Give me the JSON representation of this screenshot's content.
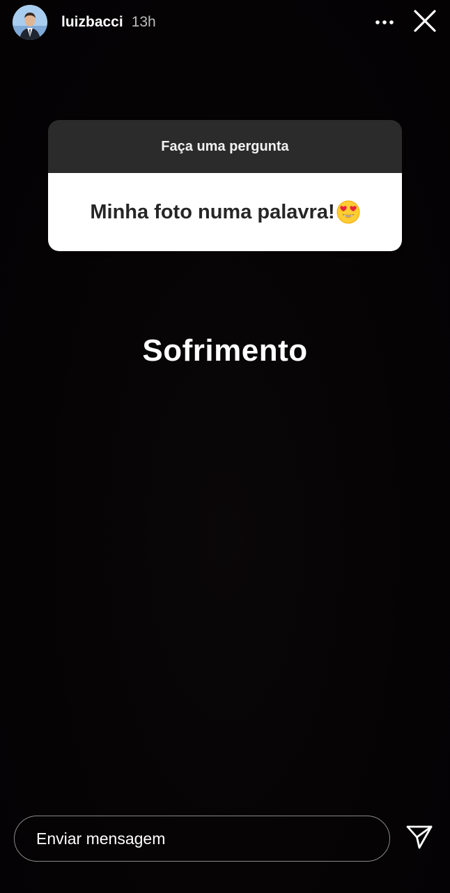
{
  "header": {
    "username": "luizbacci",
    "timestamp": "13h",
    "avatar_icon": "profile-photo",
    "more_icon": "more-horizontal-icon",
    "close_icon": "close-icon"
  },
  "question_sticker": {
    "prompt": "Faça uma pergunta",
    "question": "Minha foto numa palavra!",
    "emoji_icon": "heart-eyes-emoji-icon"
  },
  "answer": {
    "text": "Sofrimento"
  },
  "footer": {
    "message_placeholder": "Enviar mensagem",
    "send_icon": "send-icon"
  },
  "colors": {
    "background": "#050304",
    "card_header": "#2b2b2b",
    "card_body": "#ffffff",
    "text_primary": "#ffffff"
  }
}
